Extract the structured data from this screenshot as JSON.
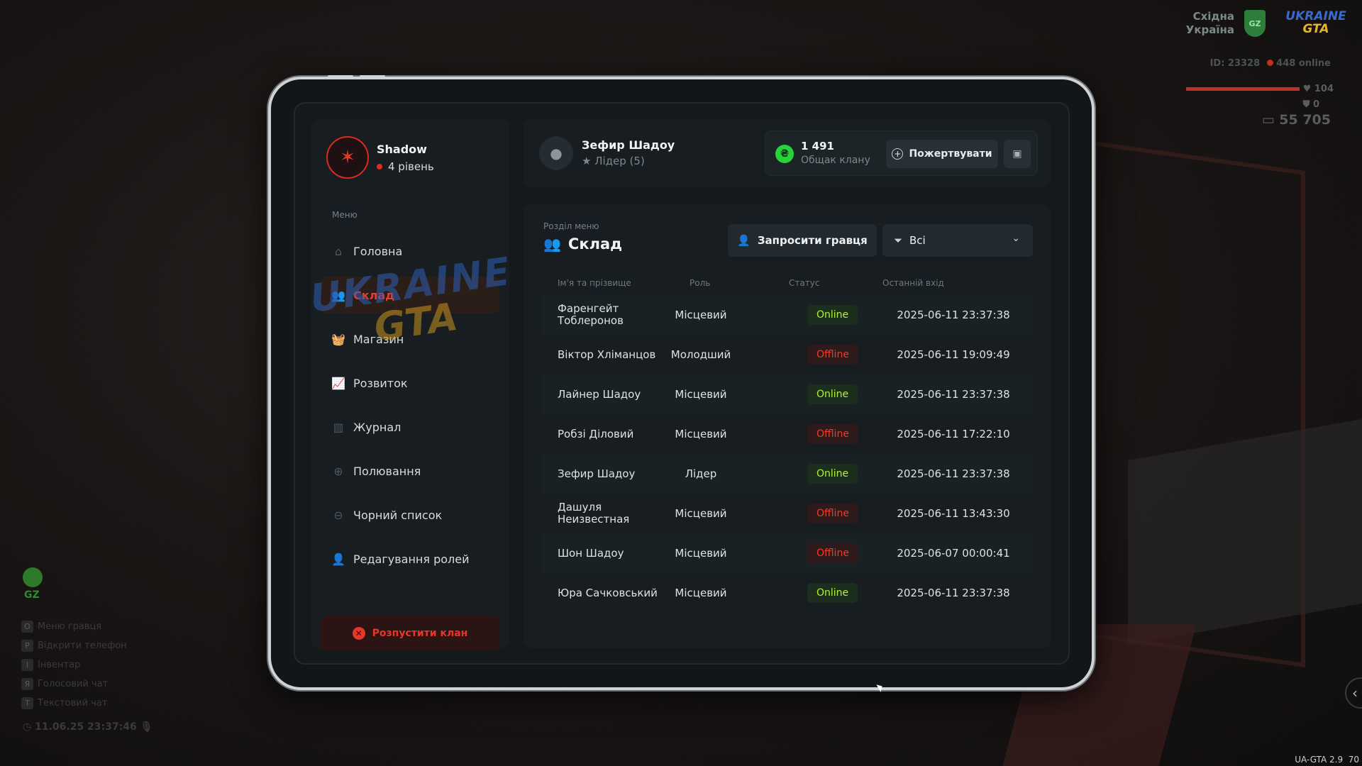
{
  "hud": {
    "region": "Східна\nУкраїна",
    "region_line1": "Східна",
    "region_line2": "Україна",
    "shield_label": "GZ",
    "logo_line1": "UKRAINE",
    "logo_line2": "GTA",
    "player_id": "ID: 23328",
    "online": "448 online",
    "health": "104",
    "armor": "0",
    "money": "55 705",
    "gz_label": "GZ",
    "keys": [
      {
        "key": "O",
        "label": "Меню гравця"
      },
      {
        "key": "P",
        "label": "Відкрити телефон"
      },
      {
        "key": "I",
        "label": "Інвентар"
      },
      {
        "key": "Я",
        "label": "Голосовий чат"
      },
      {
        "key": "T",
        "label": "Текстовий чат"
      }
    ],
    "clock": "11.06.25 23:37:46",
    "version": "UA-GTA 2.9",
    "version_extra": "70"
  },
  "profile": {
    "name": "Shadow",
    "level": "4 рівень"
  },
  "sidebar": {
    "menu_label": "Меню",
    "items": [
      {
        "label": "Головна",
        "icon": "home-icon"
      },
      {
        "label": "Склад",
        "icon": "users-icon"
      },
      {
        "label": "Магазин",
        "icon": "basket-icon"
      },
      {
        "label": "Розвиток",
        "icon": "chart-icon"
      },
      {
        "label": "Журнал",
        "icon": "book-icon"
      },
      {
        "label": "Полювання",
        "icon": "crosshair-icon"
      },
      {
        "label": "Чорний список",
        "icon": "minus-circle-icon"
      },
      {
        "label": "Редагування ролей",
        "icon": "user-edit-icon"
      }
    ],
    "active_index": 1,
    "disband_label": "Розпустити клан"
  },
  "user": {
    "name": "Зефир Шадоу",
    "role": "Лідер (5)"
  },
  "treasury": {
    "value": "1 491",
    "label": "Общак клану",
    "donate_label": "Пожертвувати",
    "coin_symbol": "₴"
  },
  "members": {
    "section_label": "Розділ меню",
    "title": "Склад",
    "invite_label": "Запросити гравця",
    "filter_value": "Всі",
    "columns": {
      "name": "Ім'я та прізвище",
      "role": "Роль",
      "status": "Статус",
      "last": "Останній вхід"
    },
    "rows": [
      {
        "name": "Фаренгейт Тоблеронов",
        "role": "Місцевий",
        "status": "Online",
        "last": "2025-06-11 23:37:38"
      },
      {
        "name": "Віктор Хліманцов",
        "role": "Молодший",
        "status": "Offline",
        "last": "2025-06-11 19:09:49"
      },
      {
        "name": "Лайнер Шадоу",
        "role": "Місцевий",
        "status": "Online",
        "last": "2025-06-11 23:37:38"
      },
      {
        "name": "Робзі Діловий",
        "role": "Місцевий",
        "status": "Offline",
        "last": "2025-06-11 17:22:10"
      },
      {
        "name": "Зефир Шадоу",
        "role": "Лідер",
        "status": "Online",
        "last": "2025-06-11 23:37:38"
      },
      {
        "name": "Дашуля Неизвестная",
        "role": "Місцевий",
        "status": "Offline",
        "last": "2025-06-11 13:43:30"
      },
      {
        "name": "Шон Шадоу",
        "role": "Місцевий",
        "status": "Offline",
        "last": "2025-06-07 00:00:41"
      },
      {
        "name": "Юра Сачковський",
        "role": "Місцевий",
        "status": "Online",
        "last": "2025-06-11 23:37:38"
      }
    ]
  },
  "watermark": {
    "line1": "UKRAINE",
    "line2": "GTA"
  },
  "colors": {
    "accent": "#ef3b27",
    "online": "#b4f23a",
    "offline": "#f23a2a",
    "coin": "#26d33a"
  }
}
